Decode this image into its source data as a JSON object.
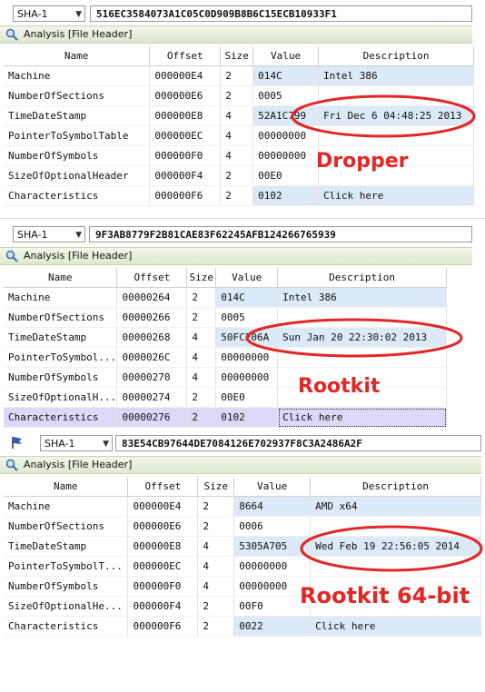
{
  "panels": [
    {
      "hash_algo": "SHA-1",
      "hash_value": "516EC3584073A1C05C0D909B8B6C15ECB10933F1",
      "analysis_title": "Analysis [File Header]",
      "columns": [
        "Name",
        "Offset",
        "Size",
        "Value",
        "Description"
      ],
      "rows": [
        {
          "name": "Machine",
          "offset": "000000E4",
          "size": "2",
          "value": "014C",
          "desc": "Intel 386"
        },
        {
          "name": "NumberOfSections",
          "offset": "000000E6",
          "size": "2",
          "value": "0005",
          "desc": ""
        },
        {
          "name": "TimeDateStamp",
          "offset": "000000E8",
          "size": "4",
          "value": "52A1C799",
          "desc": "Fri Dec 6 04:48:25 2013"
        },
        {
          "name": "PointerToSymbolTable",
          "offset": "000000EC",
          "size": "4",
          "value": "00000000",
          "desc": ""
        },
        {
          "name": "NumberOfSymbols",
          "offset": "000000F0",
          "size": "4",
          "value": "00000000",
          "desc": ""
        },
        {
          "name": "SizeOfOptionalHeader",
          "offset": "000000F4",
          "size": "2",
          "value": "00E0",
          "desc": ""
        },
        {
          "name": "Characteristics",
          "offset": "000000F6",
          "size": "2",
          "value": "0102",
          "desc": "Click here"
        }
      ],
      "label": "Dropper"
    },
    {
      "hash_algo": "SHA-1",
      "hash_value": "9F3AB8779F2B81CAE83F62245AFB124266765939",
      "analysis_title": "Analysis [File Header]",
      "columns": [
        "Name",
        "Offset",
        "Size",
        "Value",
        "Description"
      ],
      "rows": [
        {
          "name": "Machine",
          "offset": "00000264",
          "size": "2",
          "value": "014C",
          "desc": "Intel 386"
        },
        {
          "name": "NumberOfSections",
          "offset": "00000266",
          "size": "2",
          "value": "0005",
          "desc": ""
        },
        {
          "name": "TimeDateStamp",
          "offset": "00000268",
          "size": "4",
          "value": "50FC206A",
          "desc": "Sun Jan 20 22:30:02 2013"
        },
        {
          "name": "PointerToSymbol...",
          "offset": "0000026C",
          "size": "4",
          "value": "00000000",
          "desc": ""
        },
        {
          "name": "NumberOfSymbols",
          "offset": "00000270",
          "size": "4",
          "value": "00000000",
          "desc": ""
        },
        {
          "name": "SizeOfOptionalH...",
          "offset": "00000274",
          "size": "2",
          "value": "00E0",
          "desc": ""
        },
        {
          "name": "Characteristics",
          "offset": "00000276",
          "size": "2",
          "value": "0102",
          "desc": "Click here"
        }
      ],
      "label": "Rootkit"
    },
    {
      "hash_algo": "SHA-1",
      "hash_value": "83E54CB97644DE7084126E702937F8C3A2486A2F",
      "analysis_title": "Analysis [File Header]",
      "columns": [
        "Name",
        "Offset",
        "Size",
        "Value",
        "Description"
      ],
      "rows": [
        {
          "name": "Machine",
          "offset": "000000E4",
          "size": "2",
          "value": "8664",
          "desc": "AMD x64"
        },
        {
          "name": "NumberOfSections",
          "offset": "000000E6",
          "size": "2",
          "value": "0006",
          "desc": ""
        },
        {
          "name": "TimeDateStamp",
          "offset": "000000E8",
          "size": "4",
          "value": "5305A705",
          "desc": "Wed Feb 19 22:56:05 2014"
        },
        {
          "name": "PointerToSymbolT...",
          "offset": "000000EC",
          "size": "4",
          "value": "00000000",
          "desc": ""
        },
        {
          "name": "NumberOfSymbols",
          "offset": "000000F0",
          "size": "4",
          "value": "00000000",
          "desc": ""
        },
        {
          "name": "SizeOfOptionalHe...",
          "offset": "000000F4",
          "size": "2",
          "value": "00F0",
          "desc": ""
        },
        {
          "name": "Characteristics",
          "offset": "000000F6",
          "size": "2",
          "value": "0022",
          "desc": "Click here"
        }
      ],
      "label": "Rootkit 64-bit"
    }
  ],
  "colors": {
    "annotation": "#e32626",
    "value_highlight": "#dce9f7",
    "selected_row": "#dcd9f8",
    "analysis_bar": "#e6edd9"
  },
  "icons": {
    "analysis": "magnifier-icon",
    "third_panel_marker": "flag-icon"
  }
}
